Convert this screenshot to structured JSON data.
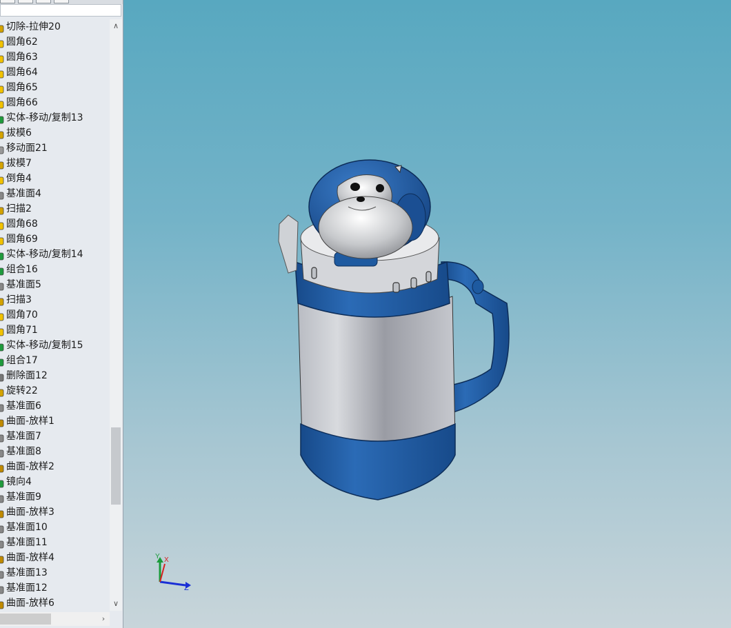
{
  "feature_tree": {
    "items": [
      {
        "label": "切除-拉伸20",
        "icon": "cut-extrude-icon"
      },
      {
        "label": "圆角62",
        "icon": "fillet-icon"
      },
      {
        "label": "圆角63",
        "icon": "fillet-icon"
      },
      {
        "label": "圆角64",
        "icon": "fillet-icon"
      },
      {
        "label": "圆角65",
        "icon": "fillet-icon"
      },
      {
        "label": "圆角66",
        "icon": "fillet-icon"
      },
      {
        "label": "实体-移动/复制13",
        "icon": "move-copy-body-icon"
      },
      {
        "label": "拔模6",
        "icon": "draft-icon"
      },
      {
        "label": "移动面21",
        "icon": "move-face-icon"
      },
      {
        "label": "拔模7",
        "icon": "draft-icon"
      },
      {
        "label": "倒角4",
        "icon": "chamfer-icon"
      },
      {
        "label": "基准面4",
        "icon": "plane-icon"
      },
      {
        "label": "扫描2",
        "icon": "sweep-icon"
      },
      {
        "label": "圆角68",
        "icon": "fillet-icon"
      },
      {
        "label": "圆角69",
        "icon": "fillet-icon"
      },
      {
        "label": "实体-移动/复制14",
        "icon": "move-copy-body-icon"
      },
      {
        "label": "组合16",
        "icon": "combine-icon"
      },
      {
        "label": "基准面5",
        "icon": "plane-icon"
      },
      {
        "label": "扫描3",
        "icon": "sweep-icon"
      },
      {
        "label": "圆角70",
        "icon": "fillet-icon"
      },
      {
        "label": "圆角71",
        "icon": "fillet-icon"
      },
      {
        "label": "实体-移动/复制15",
        "icon": "move-copy-body-icon"
      },
      {
        "label": "组合17",
        "icon": "combine-icon"
      },
      {
        "label": "删除面12",
        "icon": "delete-face-icon"
      },
      {
        "label": "旋转22",
        "icon": "revolve-icon"
      },
      {
        "label": "基准面6",
        "icon": "plane-icon"
      },
      {
        "label": "曲面-放样1",
        "icon": "surface-loft-icon"
      },
      {
        "label": "基准面7",
        "icon": "plane-icon"
      },
      {
        "label": "基准面8",
        "icon": "plane-icon"
      },
      {
        "label": "曲面-放样2",
        "icon": "surface-loft-icon"
      },
      {
        "label": "镜向4",
        "icon": "mirror-icon"
      },
      {
        "label": "基准面9",
        "icon": "plane-icon"
      },
      {
        "label": "曲面-放样3",
        "icon": "surface-loft-icon"
      },
      {
        "label": "基准面10",
        "icon": "plane-icon"
      },
      {
        "label": "基准面11",
        "icon": "plane-icon"
      },
      {
        "label": "曲面-放样4",
        "icon": "surface-loft-icon"
      },
      {
        "label": "基准面13",
        "icon": "plane-icon"
      },
      {
        "label": "基准面12",
        "icon": "plane-icon"
      },
      {
        "label": "曲面-放样6",
        "icon": "surface-loft-icon"
      }
    ]
  },
  "triad": {
    "x_label": "X",
    "y_label": "Y",
    "z_label": "Z"
  },
  "colors": {
    "viewport_top": "#58a8c0",
    "viewport_bottom": "#c8d5da",
    "model_blue": "#1f5fa8",
    "model_silver": "#c9ccd2",
    "fillet_icon": "#f2c200",
    "combine_icon": "#1e9b3c"
  }
}
